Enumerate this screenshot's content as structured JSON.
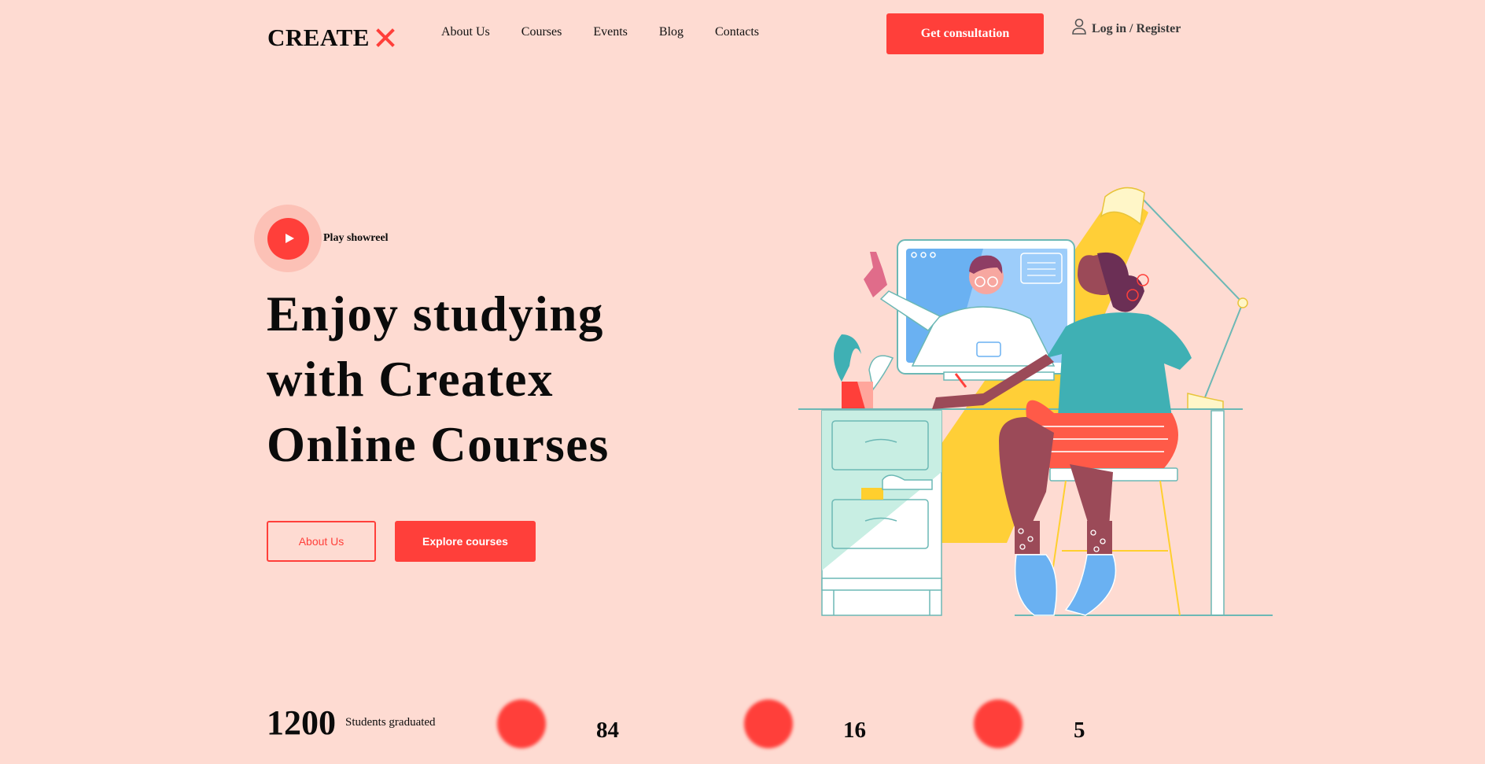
{
  "header": {
    "logo_text": "CREATE",
    "logo_mark": "X",
    "nav": [
      "About Us",
      "Courses",
      "Events",
      "Blog",
      "Contacts"
    ],
    "cta_label": "Get consultation",
    "login_label": "Log in / Register"
  },
  "hero": {
    "showreel_label": "Play showreel",
    "title": "Enjoy studying with Createx Online Courses",
    "about_button": "About Us",
    "explore_button": "Explore courses"
  },
  "stats": [
    {
      "value": "1200",
      "label": "Students graduated"
    },
    {
      "value": "84",
      "label": ""
    },
    {
      "value": "16",
      "label": ""
    },
    {
      "value": "5",
      "label": ""
    }
  ],
  "colors": {
    "background": "#FEDBD2",
    "accent": "#FF3F3A",
    "text": "#0B0B0B"
  },
  "icons": {
    "logo_mark": "x-mark-icon",
    "login": "user-icon",
    "play": "play-icon"
  }
}
